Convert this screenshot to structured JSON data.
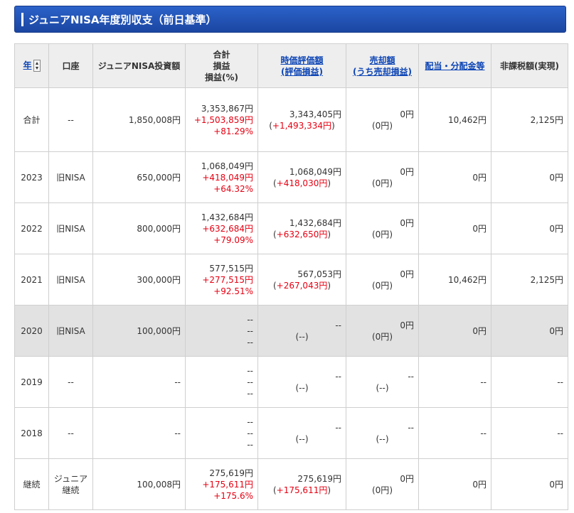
{
  "title": "ジュニアNISA年度別収支（前日基準）",
  "headers": {
    "year": "年",
    "account": "口座",
    "investment": "ジュニアNISA投資額",
    "total_pl": [
      "合計",
      "損益",
      "損益(%)"
    ],
    "market_value": [
      "時価評価額",
      "(評価損益)"
    ],
    "sale_amount": [
      "売却額",
      "(うち売却損益)"
    ],
    "dividend": "配当・分配金等",
    "tax_exempt": "非課税額(実現)"
  },
  "rows": [
    {
      "year": "合計",
      "account": "--",
      "investment": "1,850,008円",
      "total": "3,353,867円",
      "pl": "+1,503,859円",
      "pct": "+81.29%",
      "mv": "3,343,405円",
      "mv_pl": "+1,493,334円",
      "sale": "0円",
      "sale_pl": "0円",
      "dividend": "10,462円",
      "tax_exempt": "2,125円"
    },
    {
      "year": "2023",
      "account": "旧NISA",
      "investment": "650,000円",
      "total": "1,068,049円",
      "pl": "+418,049円",
      "pct": "+64.32%",
      "mv": "1,068,049円",
      "mv_pl": "+418,030円",
      "sale": "0円",
      "sale_pl": "0円",
      "dividend": "0円",
      "tax_exempt": "0円"
    },
    {
      "year": "2022",
      "account": "旧NISA",
      "investment": "800,000円",
      "total": "1,432,684円",
      "pl": "+632,684円",
      "pct": "+79.09%",
      "mv": "1,432,684円",
      "mv_pl": "+632,650円",
      "sale": "0円",
      "sale_pl": "0円",
      "dividend": "0円",
      "tax_exempt": "0円"
    },
    {
      "year": "2021",
      "account": "旧NISA",
      "investment": "300,000円",
      "total": "577,515円",
      "pl": "+277,515円",
      "pct": "+92.51%",
      "mv": "567,053円",
      "mv_pl": "+267,043円",
      "sale": "0円",
      "sale_pl": "0円",
      "dividend": "10,462円",
      "tax_exempt": "2,125円"
    },
    {
      "year": "2020",
      "account": "旧NISA",
      "investment": "100,000円",
      "total": "--",
      "pl": "--",
      "pct": "--",
      "mv": "--",
      "mv_pl": "--",
      "sale": "0円",
      "sale_pl": "0円",
      "dividend": "0円",
      "tax_exempt": "0円"
    },
    {
      "year": "2019",
      "account": "--",
      "investment": "--",
      "total": "--",
      "pl": "--",
      "pct": "--",
      "mv": "--",
      "mv_pl": "--",
      "sale": "--",
      "sale_pl": "--",
      "dividend": "--",
      "tax_exempt": "--"
    },
    {
      "year": "2018",
      "account": "--",
      "investment": "--",
      "total": "--",
      "pl": "--",
      "pct": "--",
      "mv": "--",
      "mv_pl": "--",
      "sale": "--",
      "sale_pl": "--",
      "dividend": "--",
      "tax_exempt": "--"
    },
    {
      "year": "継続",
      "account": "ジュニア継続",
      "investment": "100,008円",
      "total": "275,619円",
      "pl": "+175,611円",
      "pct": "+175.6%",
      "mv": "275,619円",
      "mv_pl": "+175,611円",
      "sale": "0円",
      "sale_pl": "0円",
      "dividend": "0円",
      "tax_exempt": "0円"
    }
  ]
}
